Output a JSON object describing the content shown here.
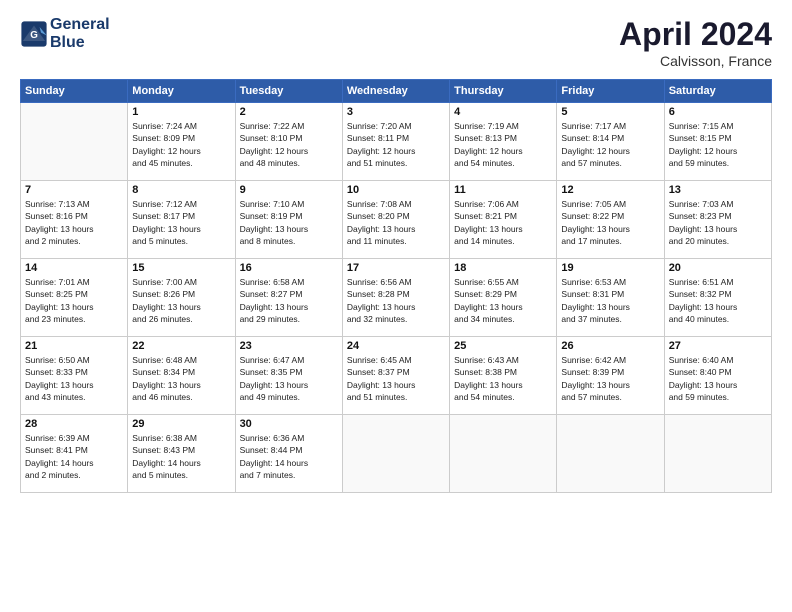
{
  "header": {
    "logo_line1": "General",
    "logo_line2": "Blue",
    "month": "April 2024",
    "location": "Calvisson, France"
  },
  "weekdays": [
    "Sunday",
    "Monday",
    "Tuesday",
    "Wednesday",
    "Thursday",
    "Friday",
    "Saturday"
  ],
  "weeks": [
    [
      {
        "day": "",
        "info": ""
      },
      {
        "day": "1",
        "info": "Sunrise: 7:24 AM\nSunset: 8:09 PM\nDaylight: 12 hours\nand 45 minutes."
      },
      {
        "day": "2",
        "info": "Sunrise: 7:22 AM\nSunset: 8:10 PM\nDaylight: 12 hours\nand 48 minutes."
      },
      {
        "day": "3",
        "info": "Sunrise: 7:20 AM\nSunset: 8:11 PM\nDaylight: 12 hours\nand 51 minutes."
      },
      {
        "day": "4",
        "info": "Sunrise: 7:19 AM\nSunset: 8:13 PM\nDaylight: 12 hours\nand 54 minutes."
      },
      {
        "day": "5",
        "info": "Sunrise: 7:17 AM\nSunset: 8:14 PM\nDaylight: 12 hours\nand 57 minutes."
      },
      {
        "day": "6",
        "info": "Sunrise: 7:15 AM\nSunset: 8:15 PM\nDaylight: 12 hours\nand 59 minutes."
      }
    ],
    [
      {
        "day": "7",
        "info": "Sunrise: 7:13 AM\nSunset: 8:16 PM\nDaylight: 13 hours\nand 2 minutes."
      },
      {
        "day": "8",
        "info": "Sunrise: 7:12 AM\nSunset: 8:17 PM\nDaylight: 13 hours\nand 5 minutes."
      },
      {
        "day": "9",
        "info": "Sunrise: 7:10 AM\nSunset: 8:19 PM\nDaylight: 13 hours\nand 8 minutes."
      },
      {
        "day": "10",
        "info": "Sunrise: 7:08 AM\nSunset: 8:20 PM\nDaylight: 13 hours\nand 11 minutes."
      },
      {
        "day": "11",
        "info": "Sunrise: 7:06 AM\nSunset: 8:21 PM\nDaylight: 13 hours\nand 14 minutes."
      },
      {
        "day": "12",
        "info": "Sunrise: 7:05 AM\nSunset: 8:22 PM\nDaylight: 13 hours\nand 17 minutes."
      },
      {
        "day": "13",
        "info": "Sunrise: 7:03 AM\nSunset: 8:23 PM\nDaylight: 13 hours\nand 20 minutes."
      }
    ],
    [
      {
        "day": "14",
        "info": "Sunrise: 7:01 AM\nSunset: 8:25 PM\nDaylight: 13 hours\nand 23 minutes."
      },
      {
        "day": "15",
        "info": "Sunrise: 7:00 AM\nSunset: 8:26 PM\nDaylight: 13 hours\nand 26 minutes."
      },
      {
        "day": "16",
        "info": "Sunrise: 6:58 AM\nSunset: 8:27 PM\nDaylight: 13 hours\nand 29 minutes."
      },
      {
        "day": "17",
        "info": "Sunrise: 6:56 AM\nSunset: 8:28 PM\nDaylight: 13 hours\nand 32 minutes."
      },
      {
        "day": "18",
        "info": "Sunrise: 6:55 AM\nSunset: 8:29 PM\nDaylight: 13 hours\nand 34 minutes."
      },
      {
        "day": "19",
        "info": "Sunrise: 6:53 AM\nSunset: 8:31 PM\nDaylight: 13 hours\nand 37 minutes."
      },
      {
        "day": "20",
        "info": "Sunrise: 6:51 AM\nSunset: 8:32 PM\nDaylight: 13 hours\nand 40 minutes."
      }
    ],
    [
      {
        "day": "21",
        "info": "Sunrise: 6:50 AM\nSunset: 8:33 PM\nDaylight: 13 hours\nand 43 minutes."
      },
      {
        "day": "22",
        "info": "Sunrise: 6:48 AM\nSunset: 8:34 PM\nDaylight: 13 hours\nand 46 minutes."
      },
      {
        "day": "23",
        "info": "Sunrise: 6:47 AM\nSunset: 8:35 PM\nDaylight: 13 hours\nand 49 minutes."
      },
      {
        "day": "24",
        "info": "Sunrise: 6:45 AM\nSunset: 8:37 PM\nDaylight: 13 hours\nand 51 minutes."
      },
      {
        "day": "25",
        "info": "Sunrise: 6:43 AM\nSunset: 8:38 PM\nDaylight: 13 hours\nand 54 minutes."
      },
      {
        "day": "26",
        "info": "Sunrise: 6:42 AM\nSunset: 8:39 PM\nDaylight: 13 hours\nand 57 minutes."
      },
      {
        "day": "27",
        "info": "Sunrise: 6:40 AM\nSunset: 8:40 PM\nDaylight: 13 hours\nand 59 minutes."
      }
    ],
    [
      {
        "day": "28",
        "info": "Sunrise: 6:39 AM\nSunset: 8:41 PM\nDaylight: 14 hours\nand 2 minutes."
      },
      {
        "day": "29",
        "info": "Sunrise: 6:38 AM\nSunset: 8:43 PM\nDaylight: 14 hours\nand 5 minutes."
      },
      {
        "day": "30",
        "info": "Sunrise: 6:36 AM\nSunset: 8:44 PM\nDaylight: 14 hours\nand 7 minutes."
      },
      {
        "day": "",
        "info": ""
      },
      {
        "day": "",
        "info": ""
      },
      {
        "day": "",
        "info": ""
      },
      {
        "day": "",
        "info": ""
      }
    ]
  ]
}
